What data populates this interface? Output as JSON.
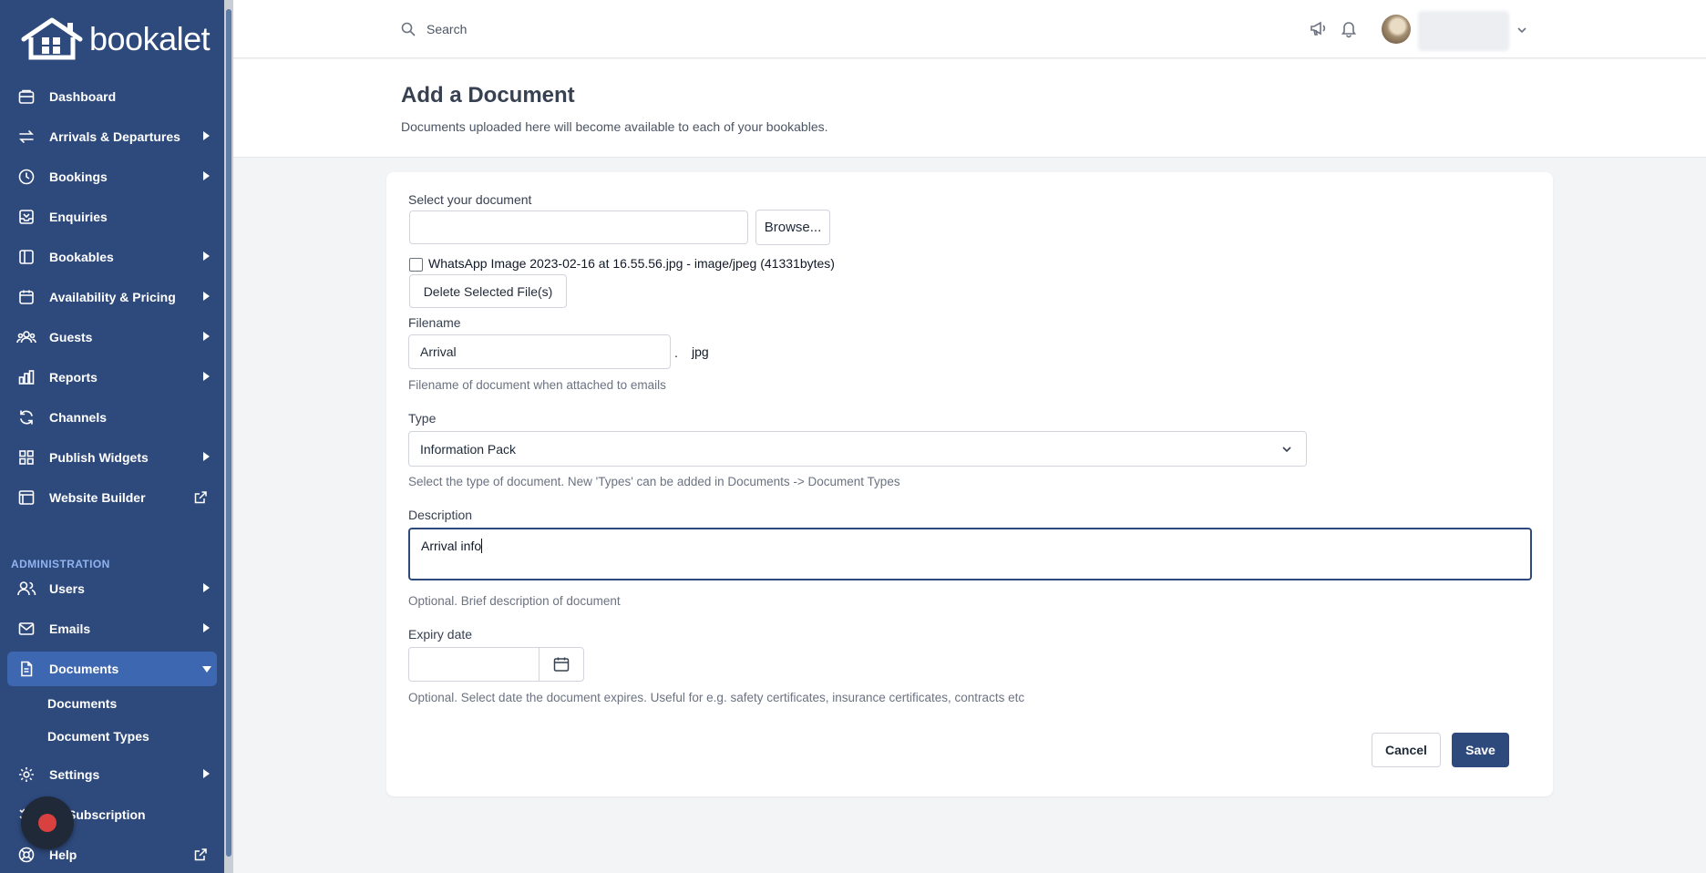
{
  "brand": {
    "name": "bookalet"
  },
  "nav": {
    "items": [
      {
        "label": "Dashboard",
        "icon": "dashboard-icon"
      },
      {
        "label": "Arrivals & Departures",
        "icon": "arrows-icon"
      },
      {
        "label": "Bookings",
        "icon": "clock-icon"
      },
      {
        "label": "Enquiries",
        "icon": "inbox-icon"
      },
      {
        "label": "Bookables",
        "icon": "book-icon"
      },
      {
        "label": "Availability & Pricing",
        "icon": "calendar-icon"
      },
      {
        "label": "Guests",
        "icon": "users-icon"
      },
      {
        "label": "Reports",
        "icon": "chart-icon"
      },
      {
        "label": "Channels",
        "icon": "refresh-icon"
      },
      {
        "label": "Publish Widgets",
        "icon": "grid-icon"
      },
      {
        "label": "Website Builder",
        "icon": "browser-icon"
      }
    ],
    "admin_label": "ADMINISTRATION",
    "admin_items": [
      {
        "label": "Users",
        "icon": "user-icon"
      },
      {
        "label": "Emails",
        "icon": "mail-icon"
      },
      {
        "label": "Documents",
        "icon": "document-icon"
      },
      {
        "label": "Settings",
        "icon": "gear-icon"
      },
      {
        "label": "Subscription",
        "icon": "checklist-icon"
      },
      {
        "label": "Help",
        "icon": "lifebuoy-icon"
      }
    ],
    "documents_sub": [
      "Documents",
      "Document Types"
    ]
  },
  "topbar": {
    "search_placeholder": "Search"
  },
  "page": {
    "title": "Add a Document",
    "subtitle": "Documents uploaded here will become available to each of your bookables."
  },
  "form": {
    "select_doc_label": "Select your document",
    "file_input_value": "",
    "browse_label": "Browse...",
    "file_entry": "WhatsApp Image 2023-02-16 at 16.55.56.jpg - image/jpeg (41331bytes)",
    "delete_label": "Delete Selected File(s)",
    "filename_label": "Filename",
    "filename_value": "Arrival",
    "filename_dot": ".",
    "filename_ext": "jpg",
    "filename_help": "Filename of document when attached to emails",
    "type_label": "Type",
    "type_value": "Information Pack",
    "type_help": "Select the type of document. New 'Types' can be added in Documents -> Document Types",
    "description_label": "Description",
    "description_value": "Arrival info",
    "description_help": "Optional. Brief description of document",
    "expiry_label": "Expiry date",
    "expiry_value": "",
    "expiry_help": "Optional. Select date the document expires. Useful for e.g. safety certificates, insurance certificates, contracts etc",
    "cancel_label": "Cancel",
    "save_label": "Save"
  },
  "colors": {
    "sidebar": "#2e4a7d",
    "active": "#3d67b0",
    "primary": "#2e4a7d",
    "admin_label": "#8fb3f0"
  }
}
